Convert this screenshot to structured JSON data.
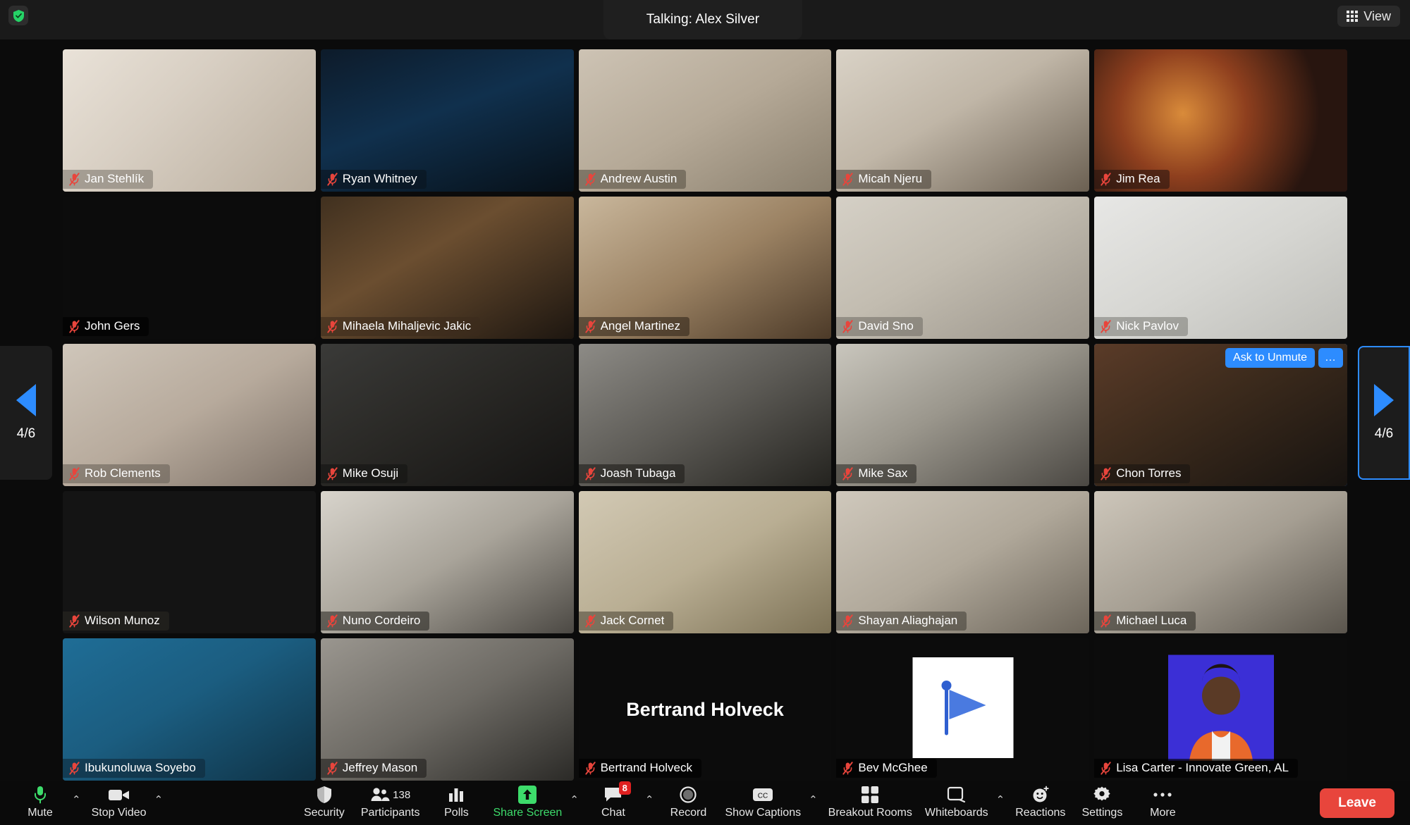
{
  "app": {
    "talking_label": "Talking: Alex Silver",
    "view_button": "View",
    "view_icon": "grid-icon",
    "security_shield_icon": "shield-check-icon"
  },
  "pager": {
    "left_label": "4/6",
    "right_label": "4/6",
    "left_icon": "chevron-left-icon",
    "right_icon": "chevron-right-icon"
  },
  "tile_actions": {
    "ask_to_unmute": "Ask to Unmute",
    "more": "…"
  },
  "participants": [
    {
      "name": "Jan Stehlík",
      "muted": true,
      "kind": "video",
      "bg": "linear-gradient(135deg,#e9e2d8 0%,#d8cfc3 40%,#b9ad9d 100%)",
      "label_bg": "rgba(120,115,105,0.55)"
    },
    {
      "name": "Ryan Whitney",
      "muted": true,
      "kind": "video",
      "bg": "linear-gradient(160deg,#0d1b2a 0%,#10304d 45%,#071018 100%)",
      "label_bg": "rgba(10,20,30,0.6)"
    },
    {
      "name": "Andrew Austin",
      "muted": true,
      "kind": "video",
      "bg": "linear-gradient(150deg,#cdc3b4 0%,#b5a997 50%,#8a7f6d 100%)",
      "label_bg": "rgba(90,84,70,0.6)"
    },
    {
      "name": "Micah Njeru",
      "muted": true,
      "kind": "video",
      "bg": "linear-gradient(150deg,#d9d2c6 0%,#c0b6a7 45%,#6b6052 100%)",
      "label_bg": "rgba(70,62,52,0.55)"
    },
    {
      "name": "Jim Rea",
      "muted": true,
      "kind": "video",
      "bg": "radial-gradient(circle at 35% 45%, #d98b3a 0%, #8e3f1e 35%, #28150f 75%)",
      "label_bg": "rgba(40,22,16,0.6)"
    },
    {
      "name": "John Gers",
      "muted": true,
      "kind": "black",
      "bg": "#0c0c0c",
      "label_bg": "rgba(0,0,0,0.6)"
    },
    {
      "name": "Mihaela Mihaljevic Jakic",
      "muted": true,
      "kind": "video",
      "bg": "linear-gradient(150deg,#40301f 0%,#6b4e30 40%,#1d1610 100%)",
      "label_bg": "rgba(60,44,28,0.6)"
    },
    {
      "name": "Angel Martinez",
      "muted": true,
      "kind": "video",
      "bg": "linear-gradient(150deg,#c9b79c 0%,#9b8263 50%,#4c3a28 100%)",
      "label_bg": "rgba(50,38,26,0.6)"
    },
    {
      "name": "David Sno",
      "muted": true,
      "kind": "video",
      "bg": "linear-gradient(150deg,#d5d0c6 0%,#c2bcb0 45%,#9a948a 100%)",
      "label_bg": "rgba(110,105,98,0.55)"
    },
    {
      "name": "Nick Pavlov",
      "muted": true,
      "kind": "video",
      "bg": "linear-gradient(150deg,#e7e7e5 0%,#d6d6d2 50%,#bdbdb8 100%)",
      "label_bg": "rgba(120,120,115,0.55)"
    },
    {
      "name": "Rob Clements",
      "muted": true,
      "kind": "video",
      "bg": "linear-gradient(150deg,#cfc6ba 0%,#b7aa9c 50%,#7c7066 100%)",
      "label_bg": "rgba(100,92,84,0.55)"
    },
    {
      "name": "Mike Osuji",
      "muted": true,
      "kind": "video",
      "bg": "linear-gradient(150deg,#3a3a38 0%,#2a2926 45%,#141312 100%)",
      "label_bg": "rgba(20,20,18,0.6)"
    },
    {
      "name": "Joash Tubaga",
      "muted": true,
      "kind": "video",
      "bg": "linear-gradient(150deg,#8d8b86 0%,#5c5a55 50%,#24231f 100%)",
      "label_bg": "rgba(30,29,25,0.6)"
    },
    {
      "name": "Mike Sax",
      "muted": true,
      "kind": "video",
      "bg": "linear-gradient(150deg,#c9c6bd 0%,#9a968c 45%,#4b4843 100%)",
      "label_bg": "rgba(45,43,38,0.6)"
    },
    {
      "name": "Chon Torres",
      "muted": true,
      "kind": "video",
      "bg": "linear-gradient(150deg,#5a3b28 0%,#3b2a1c 45%,#171310 100%)",
      "label_bg": "rgba(25,20,16,0.6)",
      "selected": true,
      "actions": [
        "ask_to_unmute",
        "more"
      ]
    },
    {
      "name": "Wilson Munoz",
      "muted": true,
      "kind": "video",
      "bg": "linear-gradient(150deg,#b9b2a8 0%,#8e8madapt 1%,#7d776d 50%,#3a3631 100%)",
      "label_bg": "rgba(40,38,34,0.6)"
    },
    {
      "name": "Nuno Cordeiro",
      "muted": true,
      "kind": "video",
      "bg": "linear-gradient(150deg,#d8d4cc 0%,#a9a49a 50%,#4c4944 100%)",
      "label_bg": "rgba(45,43,39,0.6)"
    },
    {
      "name": "Jack Cornet",
      "muted": true,
      "kind": "video",
      "bg": "linear-gradient(150deg,#d2c9b4 0%,#b9ae93 50%,#7d7256 100%)",
      "label_bg": "rgba(80,74,58,0.6)"
    },
    {
      "name": "Shayan Aliaghajan",
      "muted": true,
      "kind": "video",
      "bg": "linear-gradient(150deg,#cfc8bc 0%,#b0a89a 50%,#6c655a 100%)",
      "label_bg": "rgba(70,66,58,0.6)"
    },
    {
      "name": "Michael Luca",
      "muted": true,
      "kind": "video",
      "bg": "linear-gradient(150deg,#cdc6ba 0%,#a59e92 50%,#5a554d 100%)",
      "label_bg": "rgba(50,48,42,0.6)"
    },
    {
      "name": "Ibukunoluwa Soyebo",
      "muted": true,
      "kind": "video",
      "bg": "linear-gradient(150deg,#1f6d96 0%,#1b5d80 45%,#0f3245 100%)",
      "label_bg": "rgba(15,40,56,0.6)"
    },
    {
      "name": "Jeffrey Mason",
      "muted": true,
      "kind": "video",
      "bg": "linear-gradient(150deg,#9a968f 0%,#6d6a64 50%,#2b2a27 100%)",
      "label_bg": "rgba(30,29,26,0.6)"
    },
    {
      "name": "Bertrand Holveck",
      "muted": true,
      "kind": "name",
      "bg": "#0c0c0c",
      "label_bg": "rgba(0,0,0,0.6)",
      "display_name": "Bertrand Holveck"
    },
    {
      "name": "Bev McGhee",
      "muted": true,
      "kind": "flag",
      "bg": "#0c0c0c",
      "label_bg": "rgba(0,0,0,0.6)"
    },
    {
      "name": "Lisa Carter - Innovate Green, AL",
      "muted": true,
      "kind": "avatar",
      "bg": "#0c0c0c",
      "label_bg": "rgba(0,0,0,0.6)"
    }
  ],
  "toolbar": {
    "left": [
      {
        "label": "Mute",
        "icon": "microphone-icon",
        "caret": true,
        "accent": "#3ddc6b"
      },
      {
        "label": "Stop Video",
        "icon": "camera-icon",
        "caret": true
      }
    ],
    "center": [
      {
        "label": "Security",
        "icon": "shield-icon"
      },
      {
        "label": "Participants",
        "icon": "participants-icon",
        "count": "138"
      },
      {
        "label": "Polls",
        "icon": "polls-icon"
      },
      {
        "label": "Share Screen",
        "icon": "share-screen-icon",
        "caret": true,
        "green": true
      },
      {
        "label": "Chat",
        "icon": "chat-icon",
        "caret": true,
        "badge": "8"
      },
      {
        "label": "Record",
        "icon": "record-icon"
      },
      {
        "label": "Show Captions",
        "icon": "closed-caption-icon",
        "caret": true
      },
      {
        "label": "Breakout Rooms",
        "icon": "breakout-rooms-icon"
      },
      {
        "label": "Whiteboards",
        "icon": "whiteboard-icon",
        "caret": true
      },
      {
        "label": "Reactions",
        "icon": "reactions-icon"
      },
      {
        "label": "Settings",
        "icon": "gear-icon"
      },
      {
        "label": "More",
        "icon": "ellipsis-icon"
      }
    ],
    "leave_label": "Leave"
  },
  "colors": {
    "accent_blue": "#2d8cff",
    "green": "#3ddc6b",
    "leave_red": "#e8453c",
    "badge_red": "#e02020",
    "muted_red": "#e8453c"
  }
}
